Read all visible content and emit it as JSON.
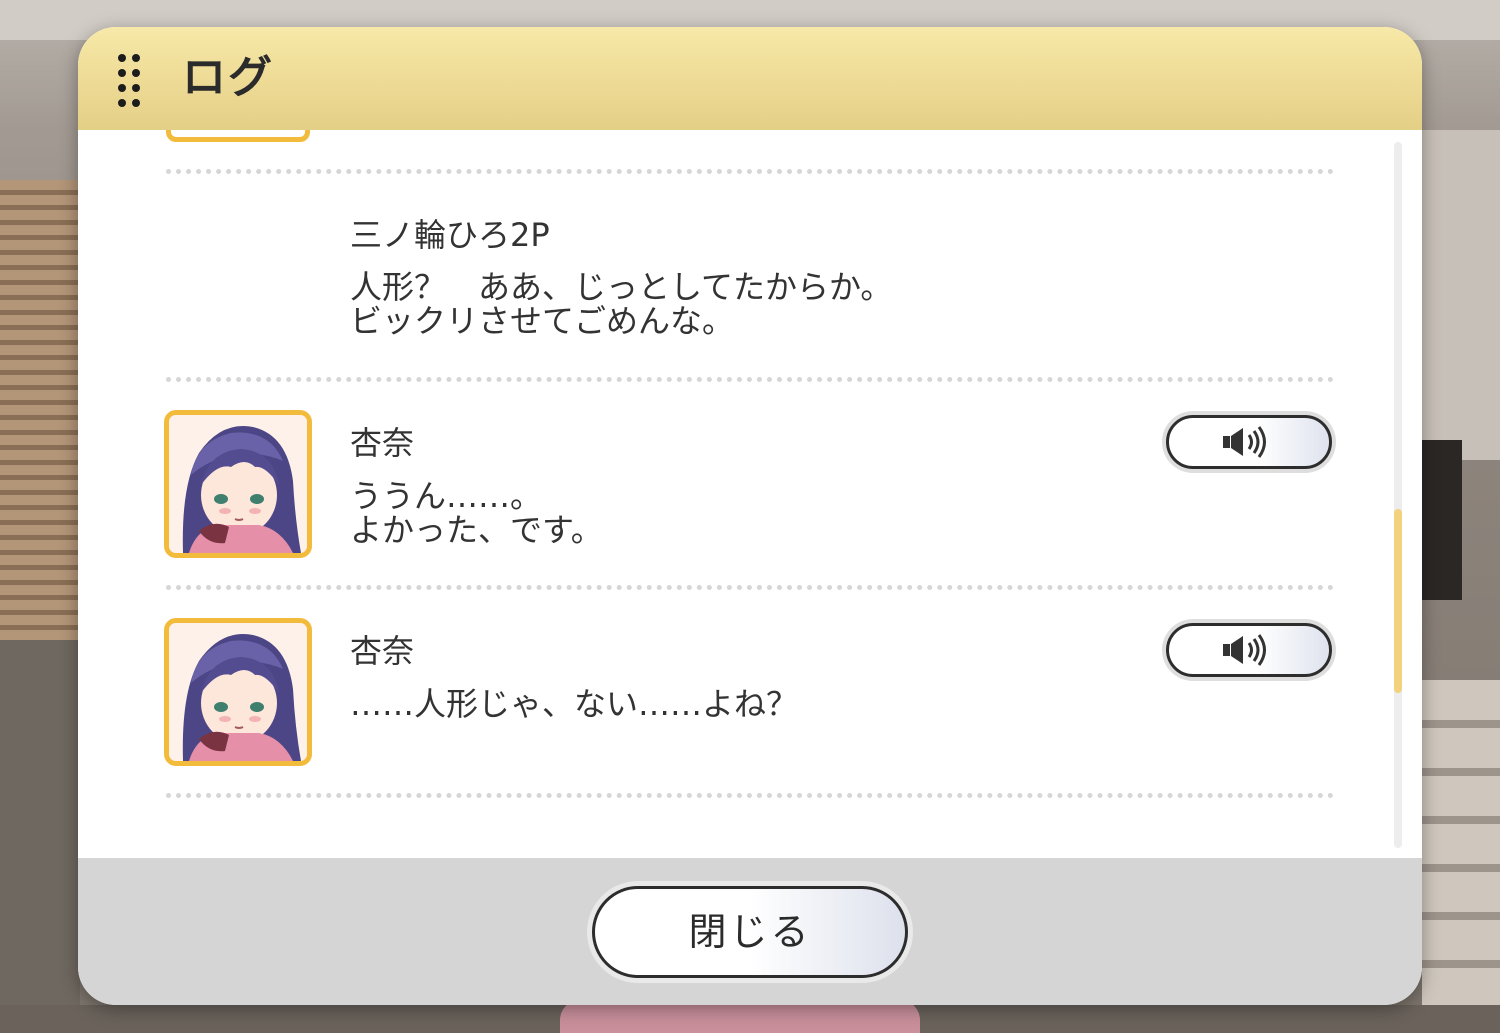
{
  "header": {
    "title": "ログ",
    "grip_icon": "grip-dots-icon"
  },
  "entries": [
    {
      "speaker": "三ノ輪ひろ2P",
      "lines": [
        "人形？　ああ、じっとしてたからか。",
        "ビックリさせてごめんな。"
      ],
      "has_avatar": false,
      "has_voice": false
    },
    {
      "speaker": "杏奈",
      "lines": [
        "ううん……。",
        "よかった、です。"
      ],
      "has_avatar": true,
      "has_voice": true,
      "voice_icon": "speaker-icon"
    },
    {
      "speaker": "杏奈",
      "lines": [
        "……人形じゃ、ない……よね？"
      ],
      "has_avatar": true,
      "has_voice": true,
      "voice_icon": "speaker-icon"
    }
  ],
  "footer": {
    "close_label": "閉じる"
  },
  "scrollbar": {
    "thumb_start_fraction": 0.52,
    "thumb_size_fraction": 0.26
  },
  "colors": {
    "header": "#ecd993",
    "frame_accent": "#f2bb3c",
    "footer": "#d5d5d5",
    "divider": "#d6d6d6",
    "scroll_thumb": "#f2d27e"
  }
}
